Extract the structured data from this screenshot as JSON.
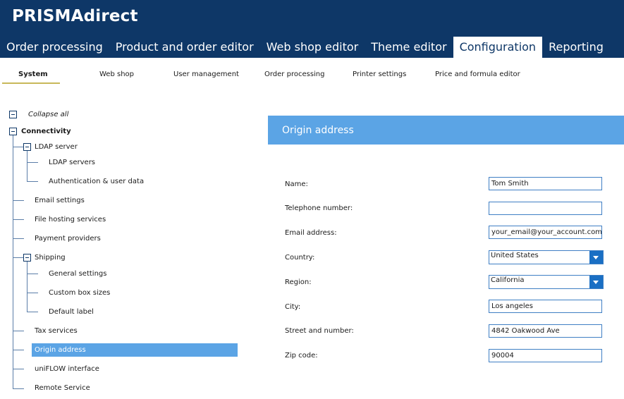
{
  "app": {
    "title": "PRISMAdirect"
  },
  "main_tabs": [
    {
      "label": "Order processing"
    },
    {
      "label": "Product and order editor"
    },
    {
      "label": "Web shop editor"
    },
    {
      "label": "Theme editor"
    },
    {
      "label": "Configuration",
      "active": true
    },
    {
      "label": "Reporting"
    }
  ],
  "sub_tabs": [
    {
      "label": "System",
      "active": true
    },
    {
      "label": "Web shop"
    },
    {
      "label": "User management"
    },
    {
      "label": "Order processing"
    },
    {
      "label": "Printer settings"
    },
    {
      "label": "Price and formula editor"
    }
  ],
  "tree": {
    "collapse_all": "Collapse all",
    "root": "Connectivity",
    "ldap": "LDAP server",
    "ldap_servers": "LDAP servers",
    "auth": "Authentication & user data",
    "email": "Email settings",
    "file_hosting": "File hosting services",
    "payment": "Payment providers",
    "shipping": "Shipping",
    "general": "General settings",
    "custom_box": "Custom box sizes",
    "default_label": "Default label",
    "tax": "Tax services",
    "origin": "Origin address",
    "uniflow": "uniFLOW interface",
    "remote": "Remote Service"
  },
  "panel": {
    "title": "Origin address",
    "fields": {
      "name": {
        "label": "Name:",
        "value": "Tom Smith"
      },
      "phone": {
        "label": "Telephone number:",
        "value": ""
      },
      "email": {
        "label": "Email address:",
        "value": "your_email@your_account.com"
      },
      "country": {
        "label": "Country:",
        "value": "United States"
      },
      "region": {
        "label": "Region:",
        "value": "California"
      },
      "city": {
        "label": "City:",
        "value": "Los angeles"
      },
      "street": {
        "label": "Street and number:",
        "value": "4842 Oakwood Ave"
      },
      "zip": {
        "label": "Zip code:",
        "value": "90004"
      }
    }
  },
  "colors": {
    "topbar": "#0e3767",
    "accent": "#5ba4e5",
    "underline": "#c8b85a"
  }
}
